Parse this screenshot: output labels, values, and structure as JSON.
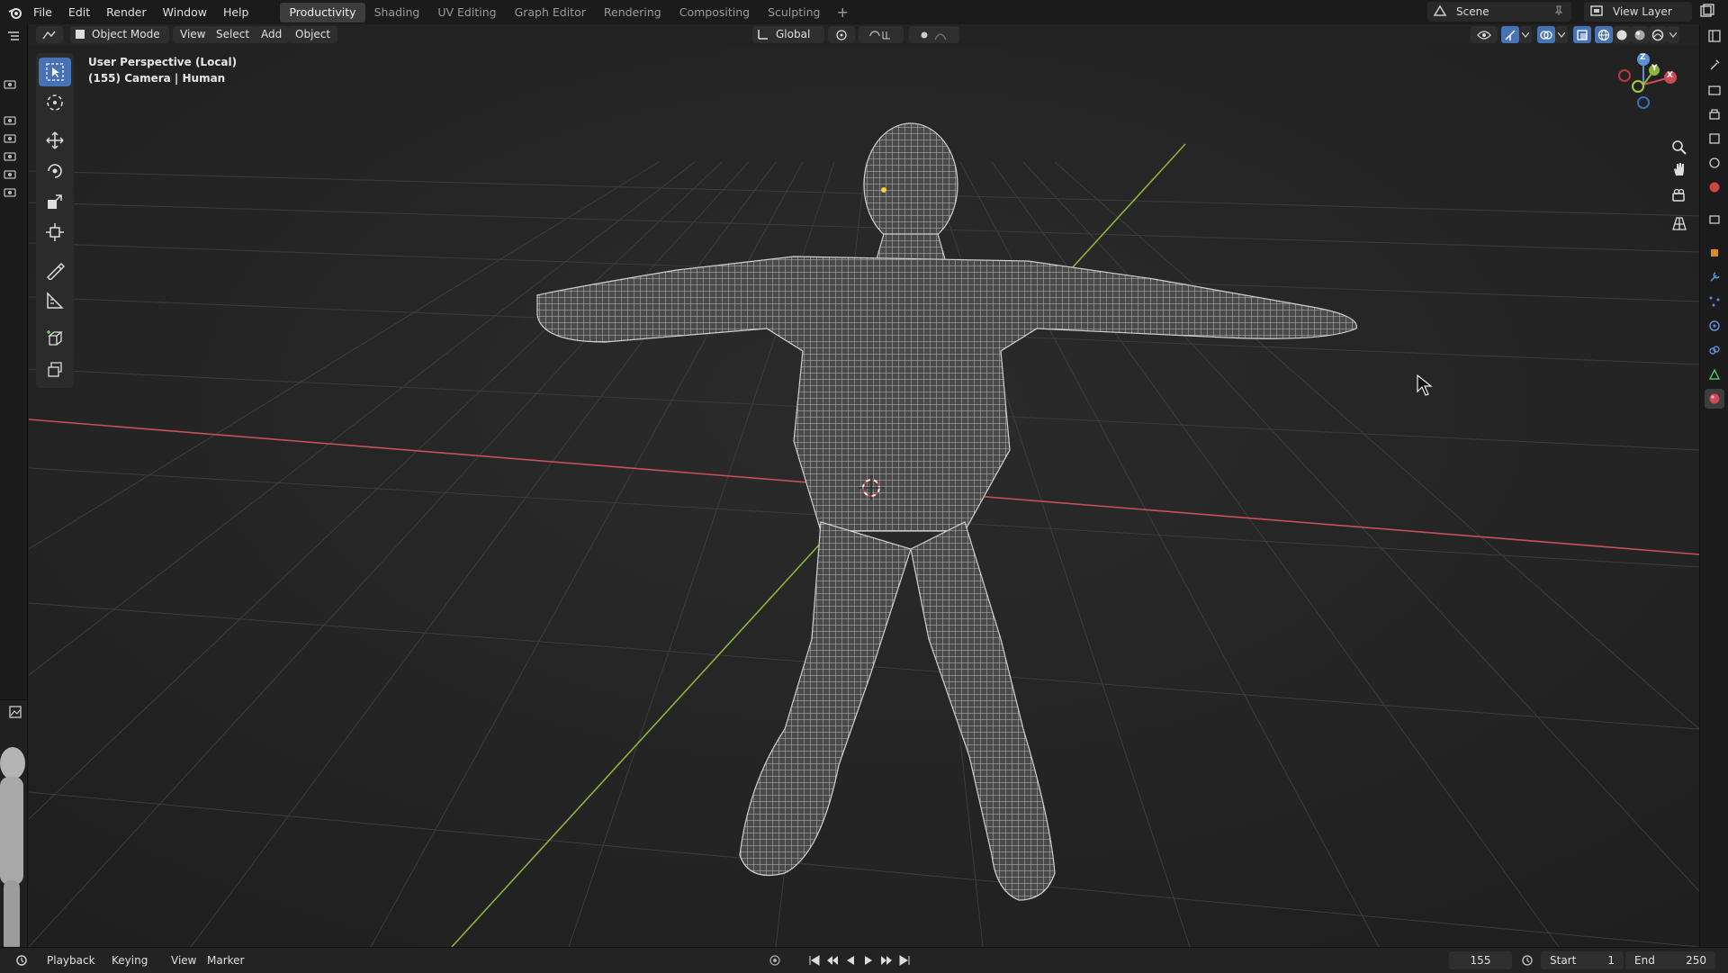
{
  "app": {
    "name": "Blender"
  },
  "menu": [
    "File",
    "Edit",
    "Render",
    "Window",
    "Help"
  ],
  "workspaces": [
    {
      "label": "Productivity",
      "active": true
    },
    {
      "label": "Shading",
      "active": false
    },
    {
      "label": "UV Editing",
      "active": false
    },
    {
      "label": "Graph Editor",
      "active": false
    },
    {
      "label": "Rendering",
      "active": false
    },
    {
      "label": "Compositing",
      "active": false
    },
    {
      "label": "Sculpting",
      "active": false
    }
  ],
  "add_workspace": "+",
  "scene": {
    "label": "Scene"
  },
  "view_layer": {
    "label": "View Layer"
  },
  "header": {
    "mode": "Object Mode",
    "menus": [
      "View",
      "Select",
      "Add",
      "Object"
    ],
    "transform_orientation": "Global"
  },
  "viewport": {
    "perspective": "User Perspective (Local)",
    "object_info": "(155) Camera | Human",
    "shading": "wireframe",
    "colors": {
      "background": "#292929",
      "grid": "#3a3a3a",
      "x_axis": "#c8505a",
      "y_axis": "#8cb43c",
      "wire": "#bdbdbd"
    }
  },
  "gizmo": {
    "x": "X",
    "y": "Y",
    "z": "Z"
  },
  "timeline": {
    "menus": [
      "Playback",
      "Keying",
      "View",
      "Marker"
    ],
    "current_frame": "155",
    "start_label": "Start",
    "start": "1",
    "end_label": "End",
    "end": "250"
  }
}
